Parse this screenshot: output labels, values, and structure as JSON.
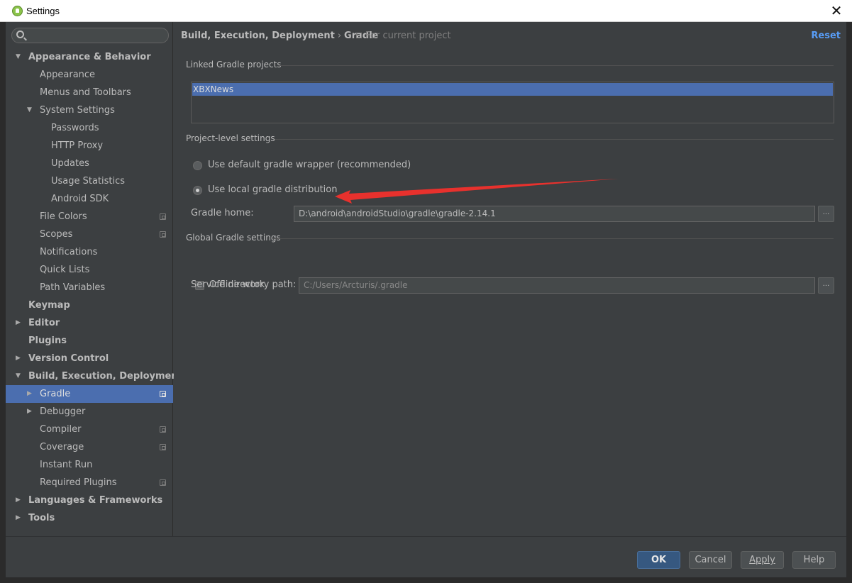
{
  "window": {
    "title": "Settings"
  },
  "search": {
    "placeholder": ""
  },
  "sidebar": {
    "items": [
      {
        "label": "Appearance & Behavior",
        "level": 0,
        "bold": true,
        "arrow": "expanded"
      },
      {
        "label": "Appearance",
        "level": 1
      },
      {
        "label": "Menus and Toolbars",
        "level": 1
      },
      {
        "label": "System Settings",
        "level": 1,
        "arrow": "expanded"
      },
      {
        "label": "Passwords",
        "level": 2
      },
      {
        "label": "HTTP Proxy",
        "level": 2
      },
      {
        "label": "Updates",
        "level": 2
      },
      {
        "label": "Usage Statistics",
        "level": 2
      },
      {
        "label": "Android SDK",
        "level": 2
      },
      {
        "label": "File Colors",
        "level": 1,
        "project_icon": true
      },
      {
        "label": "Scopes",
        "level": 1,
        "project_icon": true
      },
      {
        "label": "Notifications",
        "level": 1
      },
      {
        "label": "Quick Lists",
        "level": 1
      },
      {
        "label": "Path Variables",
        "level": 1
      },
      {
        "label": "Keymap",
        "level": 0,
        "bold": true
      },
      {
        "label": "Editor",
        "level": 0,
        "bold": true,
        "arrow": "collapsed"
      },
      {
        "label": "Plugins",
        "level": 0,
        "bold": true
      },
      {
        "label": "Version Control",
        "level": 0,
        "bold": true,
        "arrow": "collapsed"
      },
      {
        "label": "Build, Execution, Deployment",
        "level": 0,
        "bold": true,
        "arrow": "expanded"
      },
      {
        "label": "Gradle",
        "level": 1,
        "arrow": "collapsed",
        "selected": true,
        "project_icon": true
      },
      {
        "label": "Debugger",
        "level": 1,
        "arrow": "collapsed"
      },
      {
        "label": "Compiler",
        "level": 1,
        "project_icon": true
      },
      {
        "label": "Coverage",
        "level": 1,
        "project_icon": true
      },
      {
        "label": "Instant Run",
        "level": 1
      },
      {
        "label": "Required Plugins",
        "level": 1,
        "project_icon": true
      },
      {
        "label": "Languages & Frameworks",
        "level": 0,
        "bold": true,
        "arrow": "collapsed"
      },
      {
        "label": "Tools",
        "level": 0,
        "bold": true,
        "arrow": "collapsed"
      }
    ]
  },
  "header": {
    "breadcrumb_parent": "Build, Execution, Deployment",
    "breadcrumb_sep": "›",
    "breadcrumb_current": "Gradle",
    "scope_note": "For current project",
    "reset_label": "Reset"
  },
  "linked_projects": {
    "title": "Linked Gradle projects",
    "items": [
      "XBXNews"
    ]
  },
  "project_level": {
    "title": "Project-level settings",
    "option_default": "Use default gradle wrapper (recommended)",
    "option_local": "Use local gradle distribution",
    "selected_option": "local",
    "gradle_home_label": "Gradle home:",
    "gradle_home_value": "D:\\android\\androidStudio\\gradle\\gradle-2.14.1",
    "browse_label": "..."
  },
  "global_settings": {
    "title": "Global Gradle settings",
    "offline_label": "Offline work",
    "offline_checked": false,
    "service_dir_label": "Service directory path:",
    "service_dir_value": "C:/Users/Arcturis/.gradle",
    "browse_label": "..."
  },
  "buttons": {
    "ok": "OK",
    "cancel": "Cancel",
    "apply": "Apply",
    "help": "Help"
  },
  "colors": {
    "accent": "#4b6eaf",
    "link": "#589df6",
    "annotation_arrow": "#e8312d",
    "background": "#3c3f41"
  }
}
